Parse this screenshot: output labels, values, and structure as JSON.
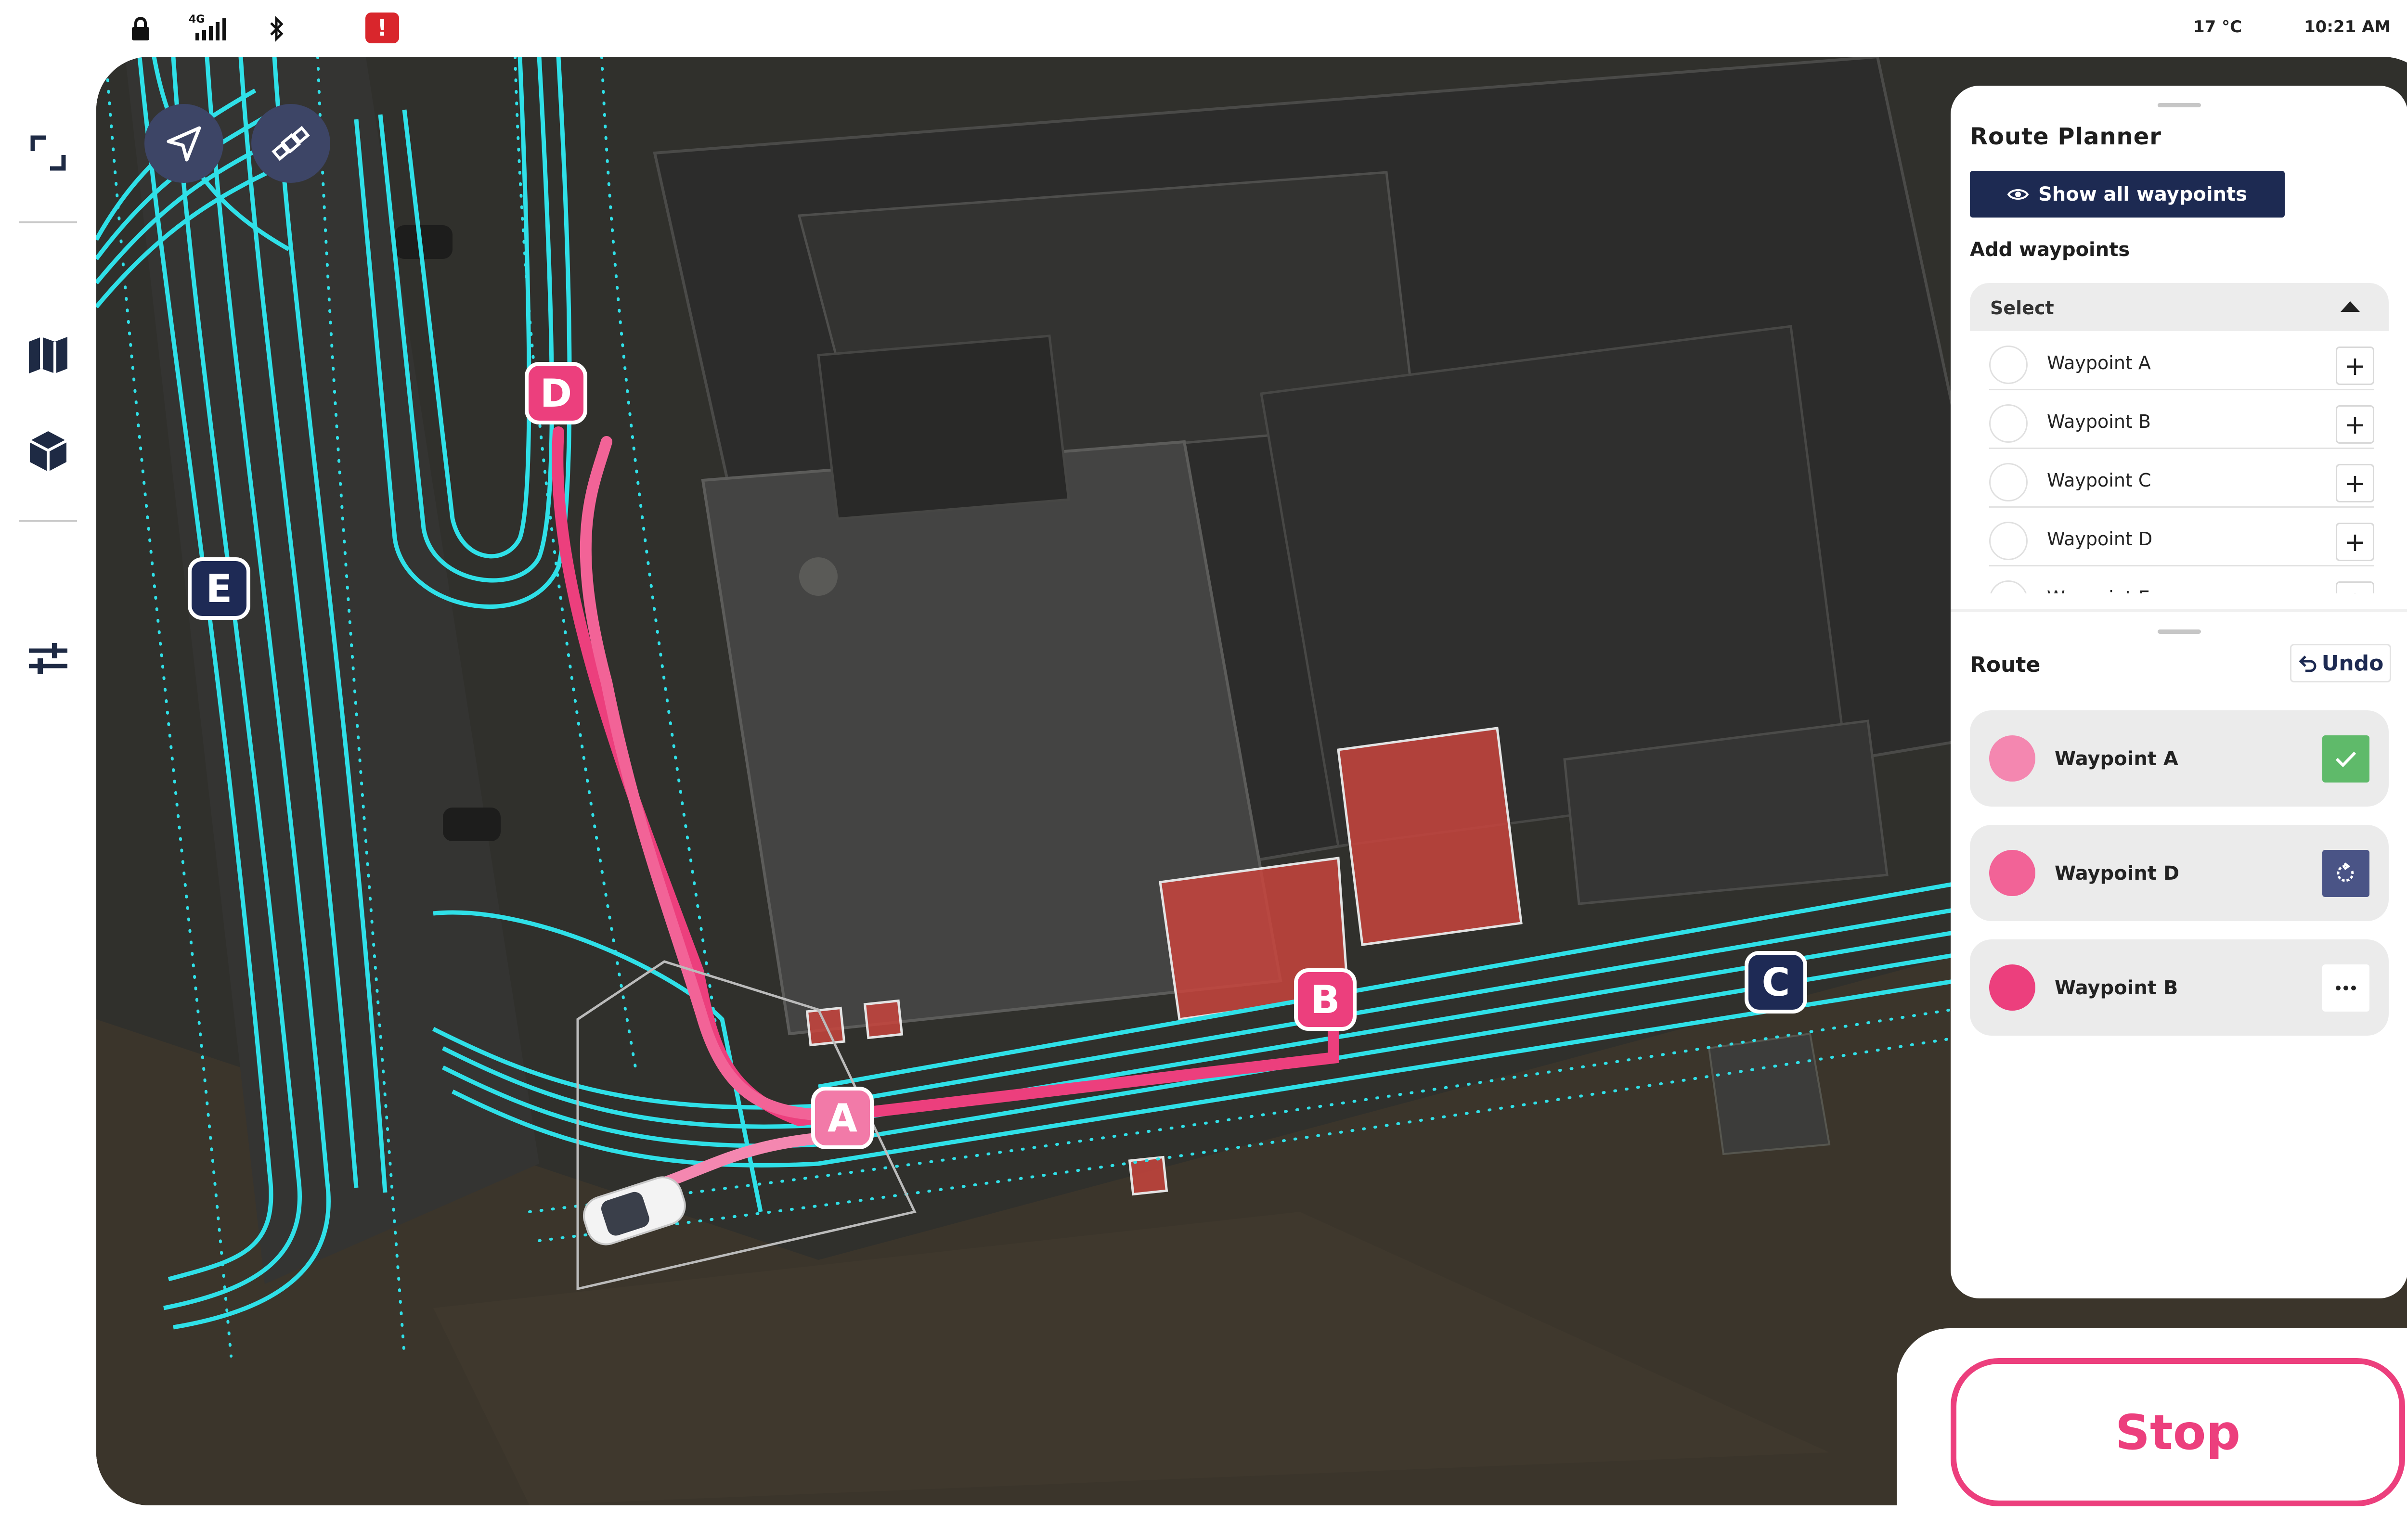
{
  "status_bar": {
    "network_label": "4G",
    "temperature": "17 °C",
    "time": "10:21 AM",
    "alert_symbol": "!"
  },
  "sidebar": {
    "items": [
      {
        "icon": "fullscreen-icon"
      },
      {
        "icon": "map-icon"
      },
      {
        "icon": "cube-icon"
      },
      {
        "icon": "sliders-icon"
      }
    ]
  },
  "map": {
    "buttons": [
      {
        "icon": "navigation-arrow-icon"
      },
      {
        "icon": "satellite-icon"
      }
    ],
    "markers": [
      {
        "id": "A",
        "label": "A"
      },
      {
        "id": "B",
        "label": "B"
      },
      {
        "id": "C",
        "label": "C"
      },
      {
        "id": "D",
        "label": "D"
      },
      {
        "id": "E",
        "label": "E"
      }
    ]
  },
  "route_planner": {
    "title": "Route Planner",
    "show_all_label": "Show all waypoints",
    "add_waypoints_label": "Add waypoints",
    "select_label": "Select",
    "waypoints": [
      {
        "label": "Waypoint A"
      },
      {
        "label": "Waypoint B"
      },
      {
        "label": "Waypoint C"
      },
      {
        "label": "Waypoint D"
      },
      {
        "label": "Waypoint E"
      }
    ],
    "add_symbol": "+",
    "route_title": "Route",
    "undo_label": "Undo",
    "route": [
      {
        "label": "Waypoint A",
        "color": "#f487b0",
        "status": "done",
        "action_icon": "check-icon"
      },
      {
        "label": "Waypoint D",
        "color": "#f26397",
        "status": "in-progress",
        "action_icon": "refresh-icon"
      },
      {
        "label": "Waypoint B",
        "color": "#ec3f7d",
        "status": "pending",
        "action_icon": "more-icon"
      }
    ]
  },
  "stop_label": "Stop",
  "colors": {
    "accent": "#ec3f7d",
    "navy": "#1d2a52",
    "lane": "#2fe0e8",
    "obstacle": "#c8443d"
  }
}
